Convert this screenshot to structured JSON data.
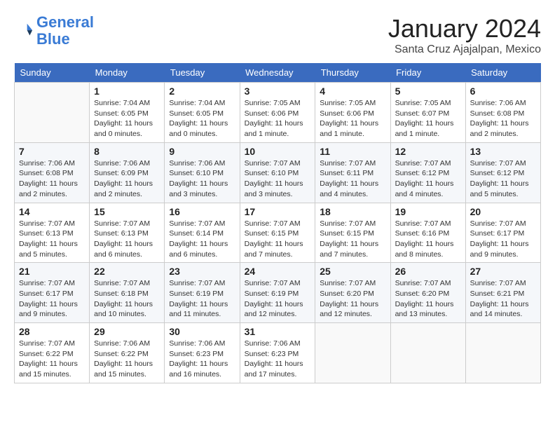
{
  "logo": {
    "line1": "General",
    "line2": "Blue"
  },
  "title": "January 2024",
  "location": "Santa Cruz Ajajalpan, Mexico",
  "days_header": [
    "Sunday",
    "Monday",
    "Tuesday",
    "Wednesday",
    "Thursday",
    "Friday",
    "Saturday"
  ],
  "weeks": [
    [
      {
        "day": "",
        "lines": []
      },
      {
        "day": "1",
        "lines": [
          "Sunrise: 7:04 AM",
          "Sunset: 6:05 PM",
          "Daylight: 11 hours",
          "and 0 minutes."
        ]
      },
      {
        "day": "2",
        "lines": [
          "Sunrise: 7:04 AM",
          "Sunset: 6:05 PM",
          "Daylight: 11 hours",
          "and 0 minutes."
        ]
      },
      {
        "day": "3",
        "lines": [
          "Sunrise: 7:05 AM",
          "Sunset: 6:06 PM",
          "Daylight: 11 hours",
          "and 1 minute."
        ]
      },
      {
        "day": "4",
        "lines": [
          "Sunrise: 7:05 AM",
          "Sunset: 6:06 PM",
          "Daylight: 11 hours",
          "and 1 minute."
        ]
      },
      {
        "day": "5",
        "lines": [
          "Sunrise: 7:05 AM",
          "Sunset: 6:07 PM",
          "Daylight: 11 hours",
          "and 1 minute."
        ]
      },
      {
        "day": "6",
        "lines": [
          "Sunrise: 7:06 AM",
          "Sunset: 6:08 PM",
          "Daylight: 11 hours",
          "and 2 minutes."
        ]
      }
    ],
    [
      {
        "day": "7",
        "lines": [
          "Sunrise: 7:06 AM",
          "Sunset: 6:08 PM",
          "Daylight: 11 hours",
          "and 2 minutes."
        ]
      },
      {
        "day": "8",
        "lines": [
          "Sunrise: 7:06 AM",
          "Sunset: 6:09 PM",
          "Daylight: 11 hours",
          "and 2 minutes."
        ]
      },
      {
        "day": "9",
        "lines": [
          "Sunrise: 7:06 AM",
          "Sunset: 6:10 PM",
          "Daylight: 11 hours",
          "and 3 minutes."
        ]
      },
      {
        "day": "10",
        "lines": [
          "Sunrise: 7:07 AM",
          "Sunset: 6:10 PM",
          "Daylight: 11 hours",
          "and 3 minutes."
        ]
      },
      {
        "day": "11",
        "lines": [
          "Sunrise: 7:07 AM",
          "Sunset: 6:11 PM",
          "Daylight: 11 hours",
          "and 4 minutes."
        ]
      },
      {
        "day": "12",
        "lines": [
          "Sunrise: 7:07 AM",
          "Sunset: 6:12 PM",
          "Daylight: 11 hours",
          "and 4 minutes."
        ]
      },
      {
        "day": "13",
        "lines": [
          "Sunrise: 7:07 AM",
          "Sunset: 6:12 PM",
          "Daylight: 11 hours",
          "and 5 minutes."
        ]
      }
    ],
    [
      {
        "day": "14",
        "lines": [
          "Sunrise: 7:07 AM",
          "Sunset: 6:13 PM",
          "Daylight: 11 hours",
          "and 5 minutes."
        ]
      },
      {
        "day": "15",
        "lines": [
          "Sunrise: 7:07 AM",
          "Sunset: 6:13 PM",
          "Daylight: 11 hours",
          "and 6 minutes."
        ]
      },
      {
        "day": "16",
        "lines": [
          "Sunrise: 7:07 AM",
          "Sunset: 6:14 PM",
          "Daylight: 11 hours",
          "and 6 minutes."
        ]
      },
      {
        "day": "17",
        "lines": [
          "Sunrise: 7:07 AM",
          "Sunset: 6:15 PM",
          "Daylight: 11 hours",
          "and 7 minutes."
        ]
      },
      {
        "day": "18",
        "lines": [
          "Sunrise: 7:07 AM",
          "Sunset: 6:15 PM",
          "Daylight: 11 hours",
          "and 7 minutes."
        ]
      },
      {
        "day": "19",
        "lines": [
          "Sunrise: 7:07 AM",
          "Sunset: 6:16 PM",
          "Daylight: 11 hours",
          "and 8 minutes."
        ]
      },
      {
        "day": "20",
        "lines": [
          "Sunrise: 7:07 AM",
          "Sunset: 6:17 PM",
          "Daylight: 11 hours",
          "and 9 minutes."
        ]
      }
    ],
    [
      {
        "day": "21",
        "lines": [
          "Sunrise: 7:07 AM",
          "Sunset: 6:17 PM",
          "Daylight: 11 hours",
          "and 9 minutes."
        ]
      },
      {
        "day": "22",
        "lines": [
          "Sunrise: 7:07 AM",
          "Sunset: 6:18 PM",
          "Daylight: 11 hours",
          "and 10 minutes."
        ]
      },
      {
        "day": "23",
        "lines": [
          "Sunrise: 7:07 AM",
          "Sunset: 6:19 PM",
          "Daylight: 11 hours",
          "and 11 minutes."
        ]
      },
      {
        "day": "24",
        "lines": [
          "Sunrise: 7:07 AM",
          "Sunset: 6:19 PM",
          "Daylight: 11 hours",
          "and 12 minutes."
        ]
      },
      {
        "day": "25",
        "lines": [
          "Sunrise: 7:07 AM",
          "Sunset: 6:20 PM",
          "Daylight: 11 hours",
          "and 12 minutes."
        ]
      },
      {
        "day": "26",
        "lines": [
          "Sunrise: 7:07 AM",
          "Sunset: 6:20 PM",
          "Daylight: 11 hours",
          "and 13 minutes."
        ]
      },
      {
        "day": "27",
        "lines": [
          "Sunrise: 7:07 AM",
          "Sunset: 6:21 PM",
          "Daylight: 11 hours",
          "and 14 minutes."
        ]
      }
    ],
    [
      {
        "day": "28",
        "lines": [
          "Sunrise: 7:07 AM",
          "Sunset: 6:22 PM",
          "Daylight: 11 hours",
          "and 15 minutes."
        ]
      },
      {
        "day": "29",
        "lines": [
          "Sunrise: 7:06 AM",
          "Sunset: 6:22 PM",
          "Daylight: 11 hours",
          "and 15 minutes."
        ]
      },
      {
        "day": "30",
        "lines": [
          "Sunrise: 7:06 AM",
          "Sunset: 6:23 PM",
          "Daylight: 11 hours",
          "and 16 minutes."
        ]
      },
      {
        "day": "31",
        "lines": [
          "Sunrise: 7:06 AM",
          "Sunset: 6:23 PM",
          "Daylight: 11 hours",
          "and 17 minutes."
        ]
      },
      {
        "day": "",
        "lines": []
      },
      {
        "day": "",
        "lines": []
      },
      {
        "day": "",
        "lines": []
      }
    ]
  ]
}
